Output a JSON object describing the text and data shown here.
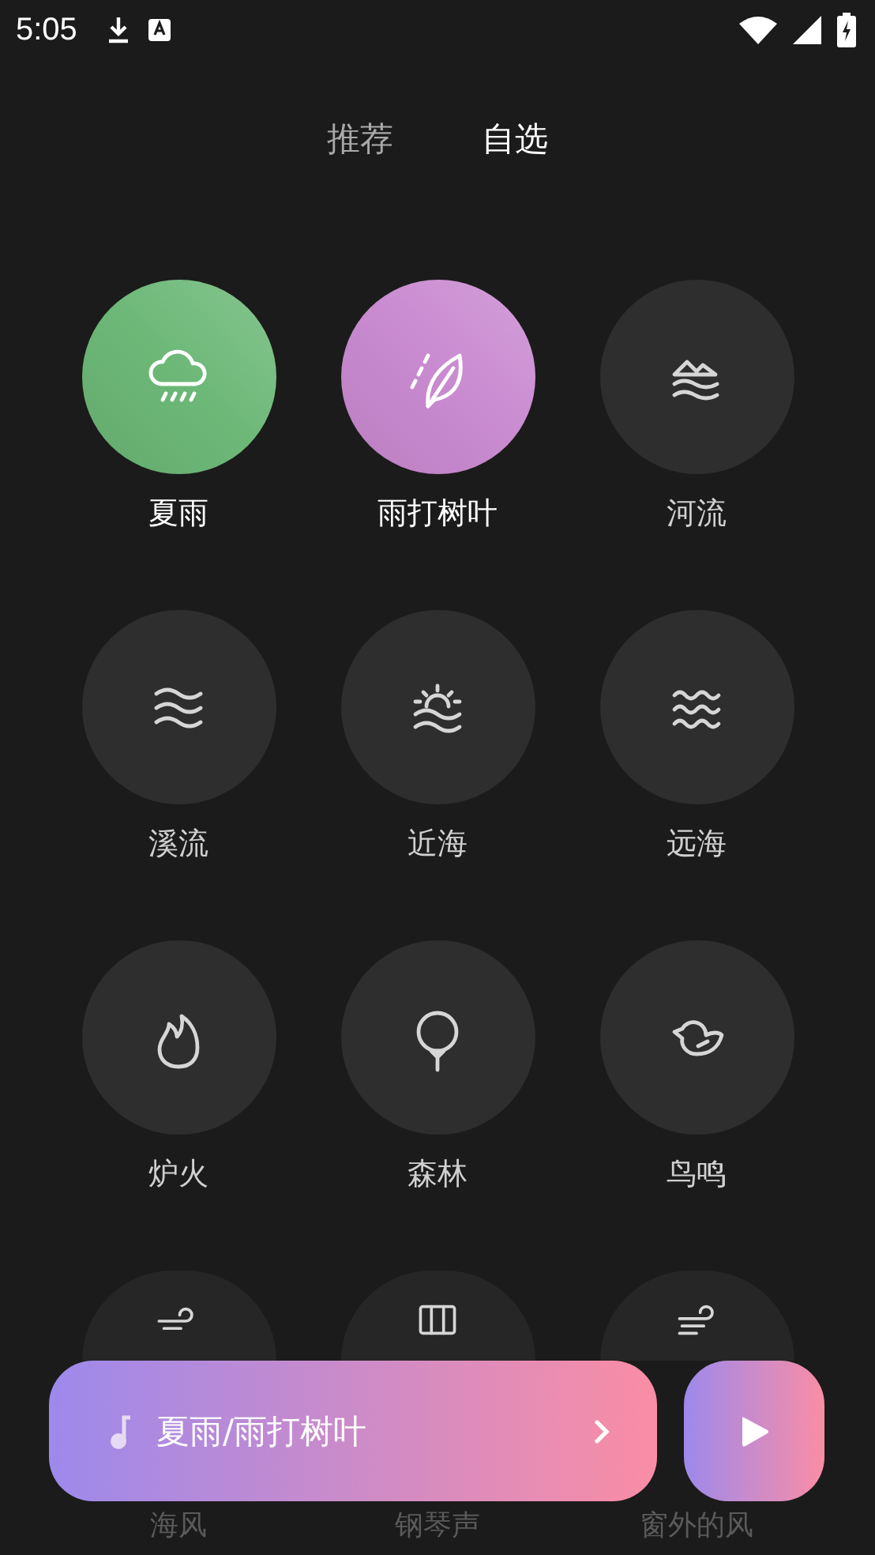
{
  "status_bar": {
    "time": "5:05"
  },
  "tabs": [
    {
      "label": "推荐",
      "selected": false
    },
    {
      "label": "自选",
      "selected": true
    }
  ],
  "sounds": [
    {
      "label": "夏雨",
      "kind": "rain",
      "selected": true,
      "color": "#6cb877"
    },
    {
      "label": "雨打树叶",
      "kind": "leaf",
      "selected": true,
      "color": "#c98ad0"
    },
    {
      "label": "河流",
      "kind": "river",
      "selected": false
    },
    {
      "label": "溪流",
      "kind": "stream",
      "selected": false
    },
    {
      "label": "近海",
      "kind": "sunrise",
      "selected": false
    },
    {
      "label": "远海",
      "kind": "waves",
      "selected": false
    },
    {
      "label": "炉火",
      "kind": "fire",
      "selected": false
    },
    {
      "label": "森林",
      "kind": "tree",
      "selected": false
    },
    {
      "label": "鸟鸣",
      "kind": "bird",
      "selected": false
    },
    {
      "label": "海风",
      "kind": "wind",
      "selected": false
    },
    {
      "label": "钢琴声",
      "kind": "piano",
      "selected": false
    },
    {
      "label": "窗外的风",
      "kind": "wind2",
      "selected": false
    }
  ],
  "player": {
    "title": "夏雨/雨打树叶"
  }
}
